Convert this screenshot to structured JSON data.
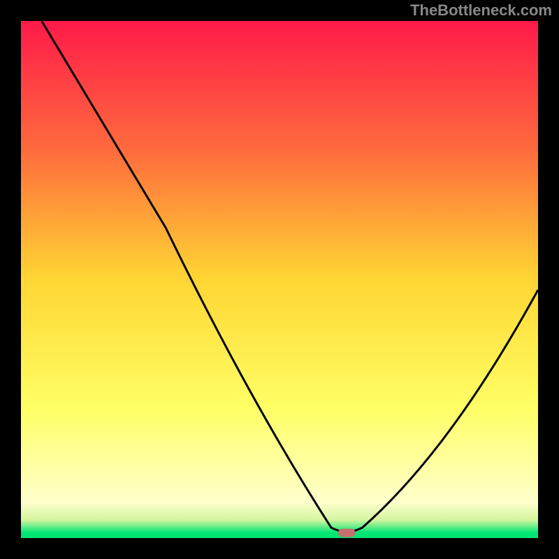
{
  "watermark": "TheBottleneck.com",
  "chart_data": {
    "type": "line",
    "title": "",
    "xlabel": "",
    "ylabel": "",
    "xlim": [
      0,
      100
    ],
    "ylim": [
      0,
      100
    ],
    "curve_points": [
      {
        "x": 4,
        "y": 100
      },
      {
        "x": 28,
        "y": 60
      },
      {
        "x": 60,
        "y": 2
      },
      {
        "x": 63,
        "y": 1
      },
      {
        "x": 66,
        "y": 2
      },
      {
        "x": 100,
        "y": 48
      }
    ],
    "marker": {
      "x": 63,
      "y": 1,
      "color": "#c77070"
    },
    "gradient_stops": [
      {
        "offset": 0,
        "color": "#ff1a4a"
      },
      {
        "offset": 25,
        "color": "#ff6b3d"
      },
      {
        "offset": 50,
        "color": "#ffd633"
      },
      {
        "offset": 75,
        "color": "#ffff66"
      },
      {
        "offset": 93,
        "color": "#ffffcc"
      },
      {
        "offset": 96.5,
        "color": "#d4f5a0"
      },
      {
        "offset": 99,
        "color": "#00e673"
      }
    ],
    "frame_color": "#000000",
    "frame_width": 30
  }
}
